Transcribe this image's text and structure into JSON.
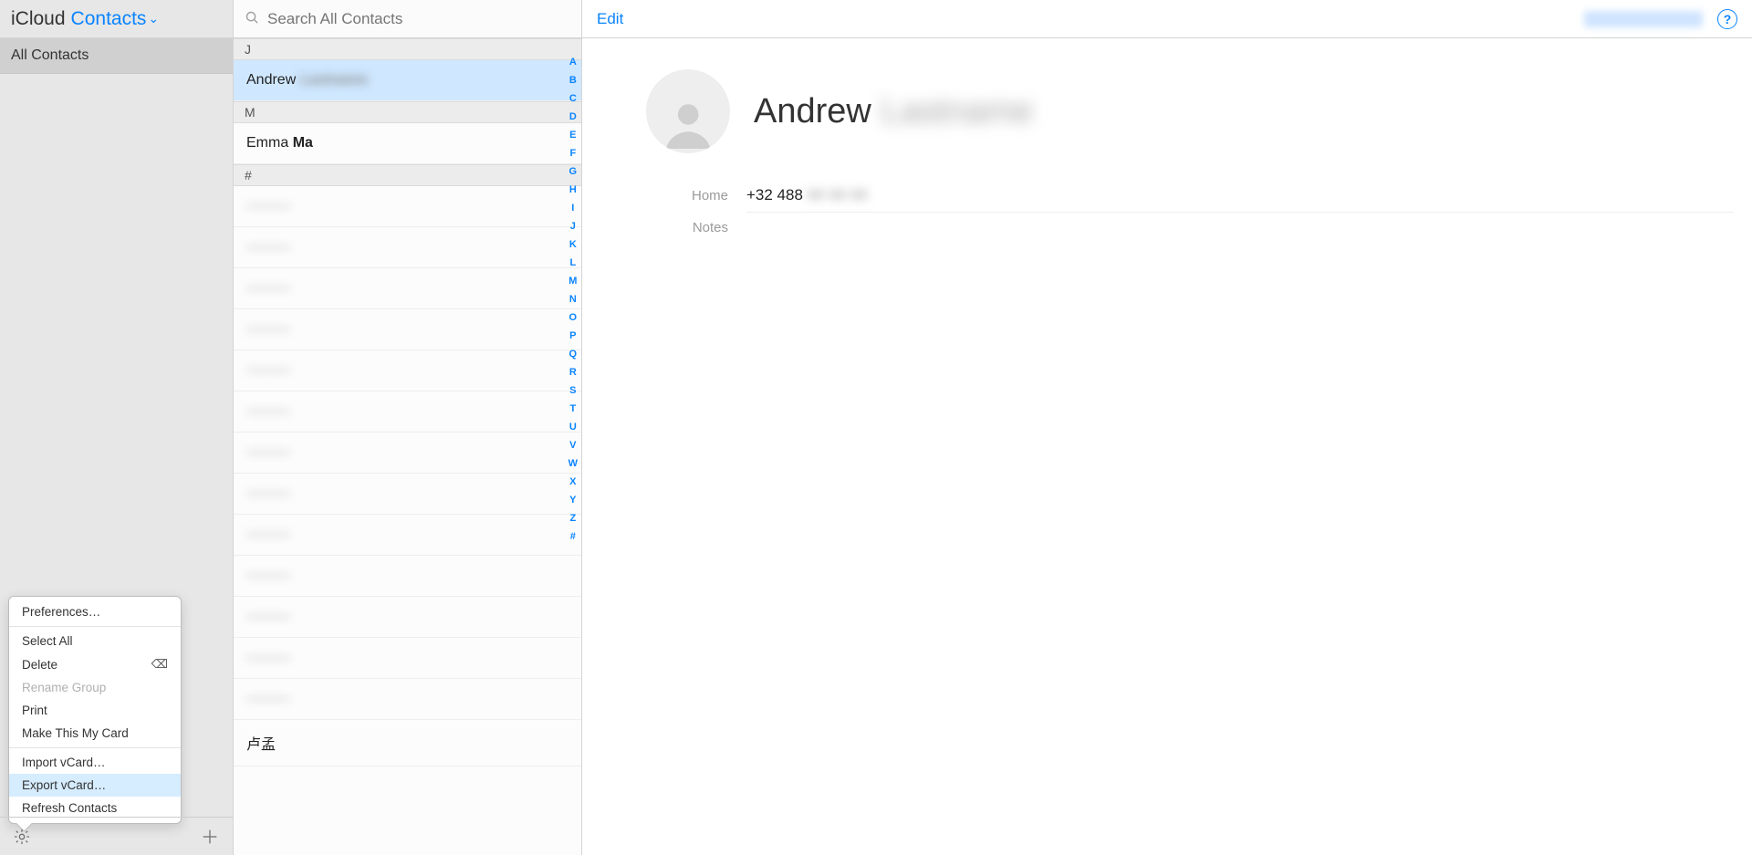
{
  "header": {
    "brand": "iCloud",
    "section": "Contacts"
  },
  "sidebar": {
    "groups": [
      "All Contacts"
    ]
  },
  "search": {
    "placeholder": "Search All Contacts"
  },
  "menu": {
    "preferences": "Preferences…",
    "select_all": "Select All",
    "delete": "Delete",
    "rename_group": "Rename Group",
    "print": "Print",
    "make_card": "Make This My Card",
    "import": "Import vCard…",
    "export": "Export vCard…",
    "refresh": "Refresh Contacts"
  },
  "list": {
    "sections": [
      {
        "letter": "J",
        "items": [
          {
            "first": "Andrew",
            "last_hidden": true,
            "selected": true
          }
        ]
      },
      {
        "letter": "M",
        "items": [
          {
            "first": "Emma",
            "last": "Ma"
          }
        ]
      },
      {
        "letter": "#",
        "items": [
          {
            "hidden": true
          },
          {
            "hidden": true
          },
          {
            "hidden": true
          },
          {
            "hidden": true
          },
          {
            "hidden": true
          },
          {
            "hidden": true
          },
          {
            "hidden": true
          },
          {
            "hidden": true
          },
          {
            "hidden": true
          },
          {
            "hidden": true
          },
          {
            "hidden": true
          },
          {
            "hidden": true
          },
          {
            "hidden": true
          },
          {
            "first": "卢孟"
          }
        ]
      }
    ],
    "alpha": [
      "A",
      "B",
      "C",
      "D",
      "E",
      "F",
      "G",
      "H",
      "I",
      "J",
      "K",
      "L",
      "M",
      "N",
      "O",
      "P",
      "Q",
      "R",
      "S",
      "T",
      "U",
      "V",
      "W",
      "X",
      "Y",
      "Z",
      "#"
    ]
  },
  "detail": {
    "edit": "Edit",
    "first_name": "Andrew",
    "phone_label": "Home",
    "phone_prefix": "+32 488",
    "notes_label": "Notes"
  }
}
